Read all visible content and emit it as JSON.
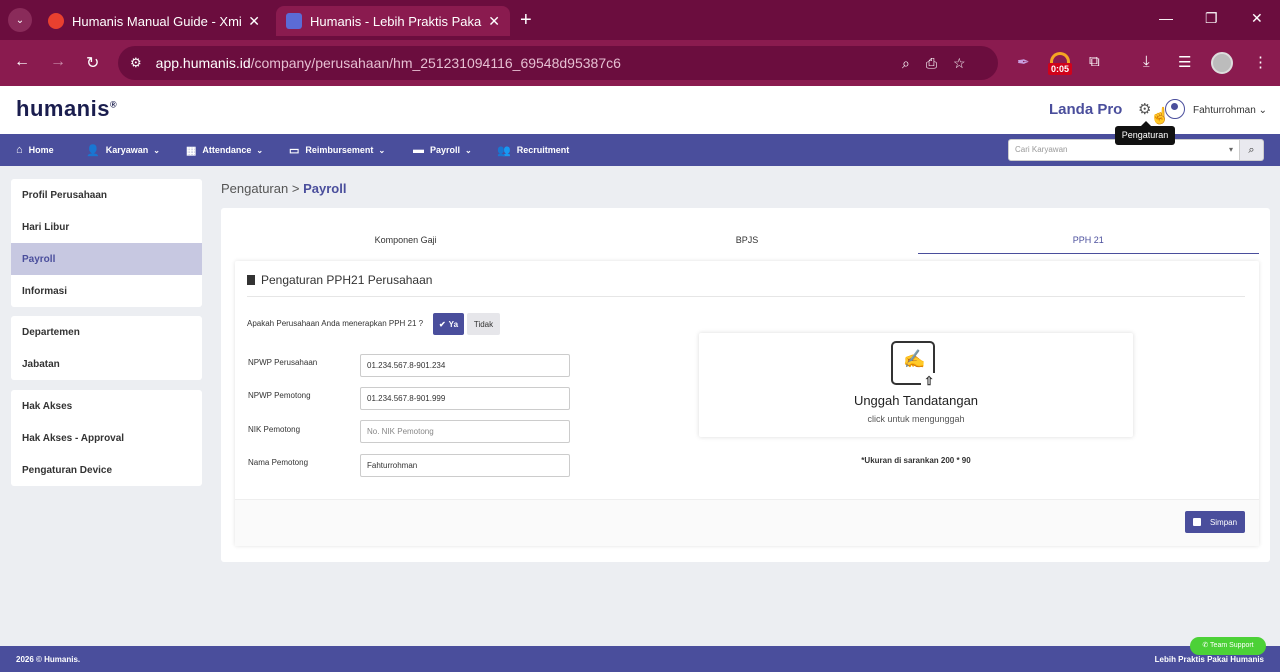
{
  "browser": {
    "tabs": [
      {
        "title": "Humanis Manual Guide - Xmind",
        "close": "✕"
      },
      {
        "title": "Humanis - Lebih Praktis Pakai Humanis",
        "close": "✕"
      }
    ],
    "new_tab": "+",
    "url_host": "app.humanis.id",
    "url_path": "/company/perusahaan/hm_251231094116_69548d95387c6",
    "timer_badge": "0:05"
  },
  "header": {
    "logo": "humanis",
    "logo_mark": "®",
    "plan": "Landa Pro",
    "user_name": "Fahturrohman",
    "tooltip": "Pengaturan"
  },
  "menu": {
    "items": [
      {
        "label": "Home",
        "icon": "home-icon"
      },
      {
        "label": "Karyawan",
        "icon": "users-icon"
      },
      {
        "label": "Attendance",
        "icon": "calendar-icon"
      },
      {
        "label": "Reimbursement",
        "icon": "money-icon"
      },
      {
        "label": "Payroll",
        "icon": "wallet-icon"
      },
      {
        "label": "Recruitment",
        "icon": "group-icon"
      }
    ],
    "search_placeholder": "Cari Karyawan"
  },
  "sidebar": {
    "groups": [
      [
        "Profil Perusahaan",
        "Hari Libur",
        "Payroll",
        "Informasi"
      ],
      [
        "Departemen",
        "Jabatan"
      ],
      [
        "Hak Akses",
        "Hak Akses - Approval",
        "Pengaturan Device"
      ]
    ],
    "active": "Payroll"
  },
  "breadcrumb": {
    "parent": "Pengaturan",
    "separator": ">",
    "current": "Payroll"
  },
  "tabs": {
    "items": [
      "Komponen Gaji",
      "BPJS",
      "PPH 21"
    ],
    "active": "PPH 21"
  },
  "form": {
    "title": "Pengaturan PPH21 Perusahaan",
    "question": "Apakah Perusahaan Anda menerapkan PPH 21 ?",
    "yes_label": "Ya",
    "no_label": "Tidak",
    "fields": [
      {
        "label": "NPWP Perusahaan",
        "value": "01.234.567.8-901.234",
        "placeholder": ""
      },
      {
        "label": "NPWP Pemotong",
        "value": "01.234.567.8-901.999",
        "placeholder": ""
      },
      {
        "label": "NIK Pemotong",
        "value": "",
        "placeholder": "No. NIK Pemotong"
      },
      {
        "label": "Nama Pemotong",
        "value": "Fahturrohman",
        "placeholder": ""
      }
    ],
    "upload_title": "Unggah Tandatangan",
    "upload_subtitle": "click untuk mengunggah",
    "size_note": "*Ukuran di sarankan 200 * 90",
    "save_label": "Simpan"
  },
  "footer": {
    "left": "2026 © Humanis.",
    "right": "Lebih Praktis Pakai Humanis",
    "support": "Team Support"
  }
}
